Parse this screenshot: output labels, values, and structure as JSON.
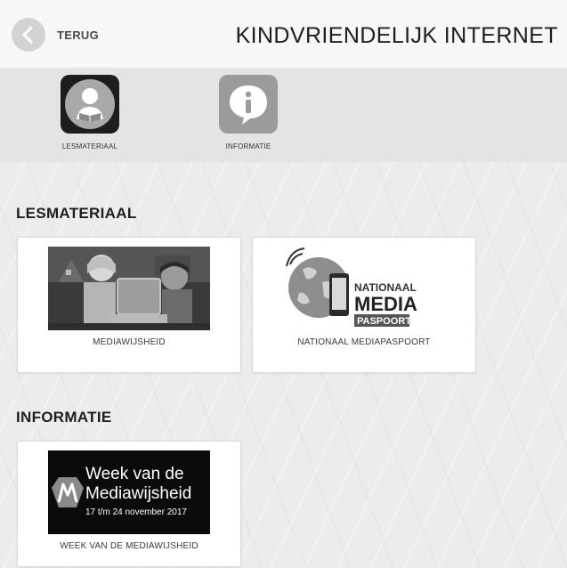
{
  "header": {
    "back_label": "TERUG",
    "title": "KINDVRIENDELIJK INTERNET"
  },
  "iconbar": {
    "items": [
      {
        "label": "LESMATERIAAL",
        "icon": "reading-child-icon"
      },
      {
        "label": "INFORMATIE",
        "icon": "info-icon"
      }
    ]
  },
  "sections": [
    {
      "title": "LESMATERIAAL",
      "cards": [
        {
          "label": "MEDIAWIJSHEID",
          "image": "children-with-laptop-photo"
        },
        {
          "label": "NATIONAAL MEDIAPASPOORT",
          "image": "nationaal-mediapaspoort-logo",
          "logo_text": {
            "line1": "NATIONAAL",
            "line2": "MEDIA",
            "line3": "PASPOORT"
          }
        }
      ]
    },
    {
      "title": "INFORMATIE",
      "cards": [
        {
          "label": "WEEK VAN DE MEDIAWIJSHEID",
          "image": "week-van-de-mediawijsheid-banner",
          "banner_text": {
            "line1": "Week van de",
            "line2": "Mediawijsheid",
            "line3": "17 t/m 24 november 2017"
          }
        }
      ]
    }
  ],
  "colors": {
    "background": "#ececec",
    "header": "#f7f7f7",
    "iconbar": "#e4e4e4",
    "card": "#ffffff"
  }
}
